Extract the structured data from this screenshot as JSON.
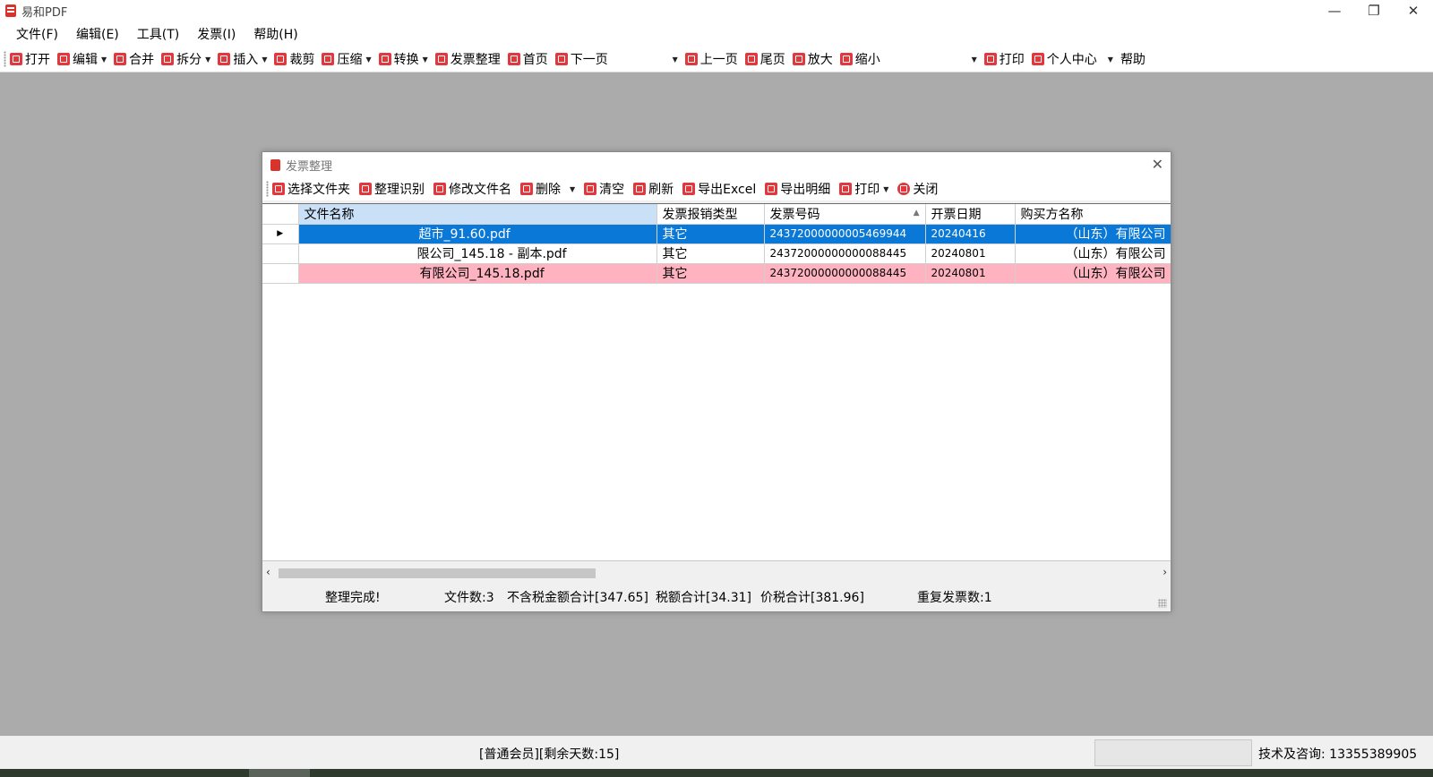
{
  "window": {
    "title": "易和PDF",
    "controls": [
      "—",
      "❐",
      "✕"
    ]
  },
  "menu": [
    "文件(F)",
    "编辑(E)",
    "工具(T)",
    "发票(I)",
    "帮助(H)"
  ],
  "toolbar": {
    "open": "打开",
    "edit": "编辑",
    "merge": "合并",
    "split": "拆分",
    "insert": "插入",
    "crop": "裁剪",
    "compress": "压缩",
    "convert": "转换",
    "invoice_organize": "发票整理",
    "first_page": "首页",
    "next_page": "下一页",
    "prev_page": "上一页",
    "last_page": "尾页",
    "zoom_in": "放大",
    "zoom_out": "缩小",
    "print": "打印",
    "user_center": "个人中心",
    "help": "帮助"
  },
  "dialog": {
    "title": "发票整理",
    "close": "✕",
    "toolbar": {
      "select_folder": "选择文件夹",
      "organize": "整理识别",
      "rename": "修改文件名",
      "delete": "删除",
      "clear": "清空",
      "refresh": "刷新",
      "export_excel": "导出Excel",
      "export_detail": "导出明细",
      "print": "打印",
      "close": "关闭"
    },
    "table": {
      "columns": [
        "文件名称",
        "发票报销类型",
        "发票号码",
        "开票日期",
        "购买方名称"
      ],
      "rows": [
        {
          "file": "超市_91.60.pdf",
          "type": "其它",
          "number": "24372000000005469944",
          "date": "20240416",
          "buyer": "（山东）有限公司",
          "state": "selected"
        },
        {
          "file": "限公司_145.18 - 副本.pdf",
          "type": "其它",
          "number": "24372000000000088445",
          "date": "20240801",
          "buyer": "（山东）有限公司",
          "state": "normal"
        },
        {
          "file": "有限公司_145.18.pdf",
          "type": "其它",
          "number": "24372000000000088445",
          "date": "20240801",
          "buyer": "（山东）有限公司",
          "state": "duplicate"
        }
      ]
    },
    "status": {
      "done": "整理完成!",
      "file_count": "文件数:3",
      "pre_tax_total": "不含税金额合计[347.65]",
      "tax_total": "税额合计[34.31]",
      "total": "价税合计[381.96]",
      "duplicates": "重复发票数:1"
    }
  },
  "statusbar": {
    "membership": "[普通会员][剩余天数:15]",
    "contact": "技术及咨询: 13355389905"
  },
  "colors": {
    "selected_row": "#0a78d7",
    "duplicate_row": "#ffb3c1",
    "icon_red": "#e0383c"
  }
}
